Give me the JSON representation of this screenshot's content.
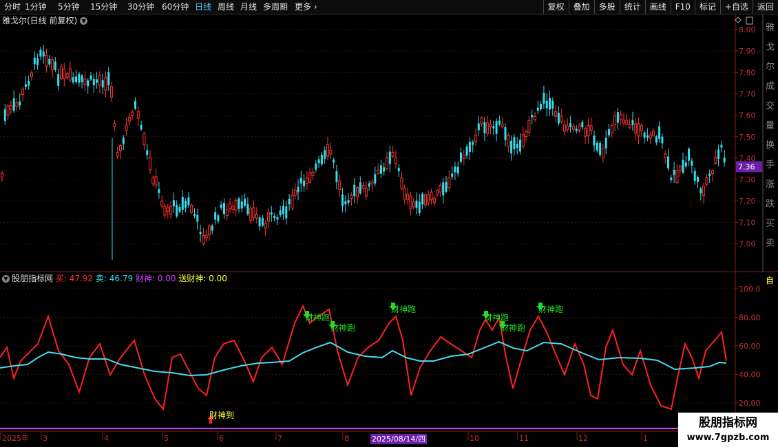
{
  "toolbar": {
    "periods": [
      "分时",
      "1分钟",
      "5分钟",
      "15分钟",
      "30分钟",
      "60分钟",
      "日线",
      "周线",
      "月线",
      "多周期",
      "更多"
    ],
    "active": "日线",
    "more_icon": "chevron-right-icon",
    "buttons": [
      "复权",
      "叠加",
      "多股",
      "统计",
      "画线",
      "F10",
      "标记",
      "+自选",
      "返回"
    ]
  },
  "main_chart": {
    "title": "雅戈尔(日线 前复权)",
    "price_ticks": [
      "8.00",
      "7.90",
      "7.80",
      "7.70",
      "7.60",
      "7.50",
      "7.40",
      "7.30",
      "7.20",
      "7.10",
      "7.00"
    ],
    "current_price": "7.36",
    "up_color": "#ff3333",
    "down_color": "#33ddee",
    "right_side_glyphs": [
      "雅",
      "戈",
      "尔",
      "成",
      "交",
      "量",
      "换",
      "手",
      "涨",
      "跌",
      "买",
      "卖"
    ]
  },
  "indicator": {
    "name": "股朋指标网",
    "values": [
      {
        "label": "买: 47.92",
        "color": "#ff3333"
      },
      {
        "label": "卖: 46.79",
        "color": "#33ddee"
      },
      {
        "label": "财神: 0.00",
        "color": "#cc44ff"
      },
      {
        "label": "送财神: 0.00",
        "color": "#ffff44"
      }
    ],
    "ticks": [
      "100.0",
      "80.00",
      "60.00",
      "40.00",
      "20.00"
    ],
    "signal_run": "财神跑",
    "signal_arrive": "财神到",
    "right_glyph": "自"
  },
  "x_axis": {
    "labels": [
      "2025年",
      "3",
      "4",
      "5",
      "6",
      "7",
      "8",
      "10",
      "11",
      "12",
      "1"
    ],
    "cursor_date": "2025/08/14/四"
  },
  "watermark": {
    "line1": "股朋指标网",
    "line2": "www.7gpzb.com"
  }
}
